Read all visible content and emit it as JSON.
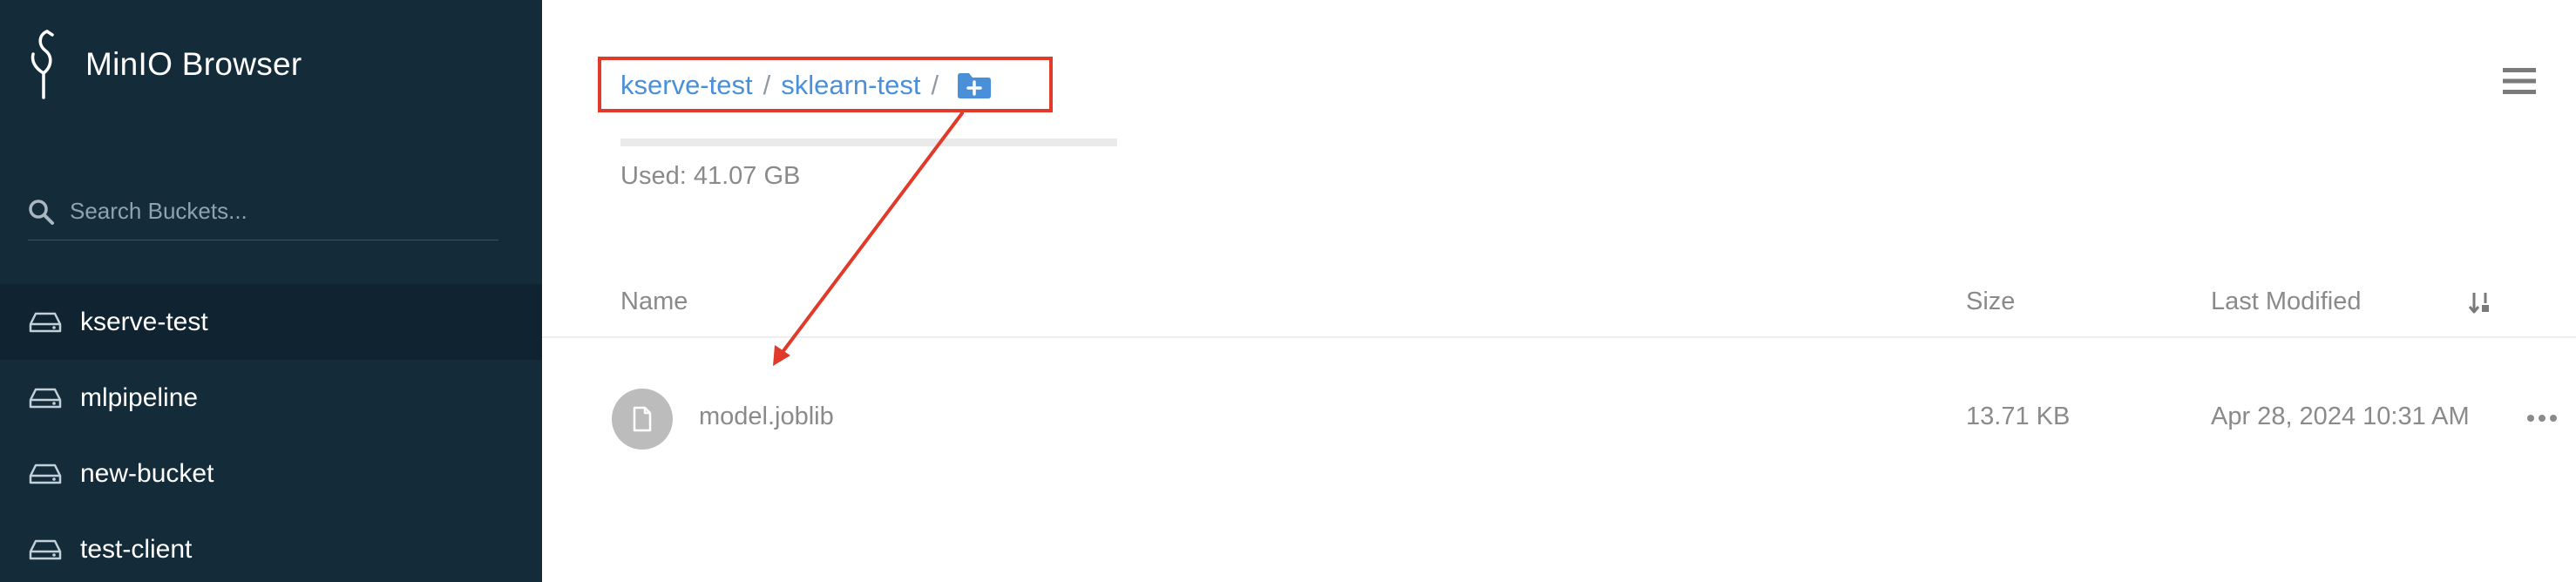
{
  "app": {
    "title": "MinIO Browser"
  },
  "search": {
    "placeholder": "Search Buckets..."
  },
  "buckets": [
    {
      "label": "kserve-test",
      "active": true
    },
    {
      "label": "mlpipeline",
      "active": false
    },
    {
      "label": "new-bucket",
      "active": false
    },
    {
      "label": "test-client",
      "active": false
    }
  ],
  "breadcrumb": {
    "items": [
      "kserve-test",
      "sklearn-test"
    ],
    "separator": "/"
  },
  "usage": {
    "text": "Used: 41.07 GB"
  },
  "table": {
    "columns": {
      "name": "Name",
      "size": "Size",
      "modified": "Last Modified"
    },
    "rows": [
      {
        "name": "model.joblib",
        "size": "13.71 KB",
        "modified": "Apr 28, 2024 10:31 AM"
      }
    ]
  },
  "icons": {
    "brand": "minio-bird-icon",
    "search": "search-icon",
    "bucket": "drive-icon",
    "new_folder": "folder-plus-icon",
    "menu": "hamburger-menu-icon",
    "sort": "sort-icon",
    "file": "file-icon",
    "more": "more-icon"
  },
  "colors": {
    "sidebar_bg": "#142c3a",
    "active_bucket_bg": "#0f2430",
    "link": "#4a90d9",
    "annotation": "#e03a2a"
  }
}
